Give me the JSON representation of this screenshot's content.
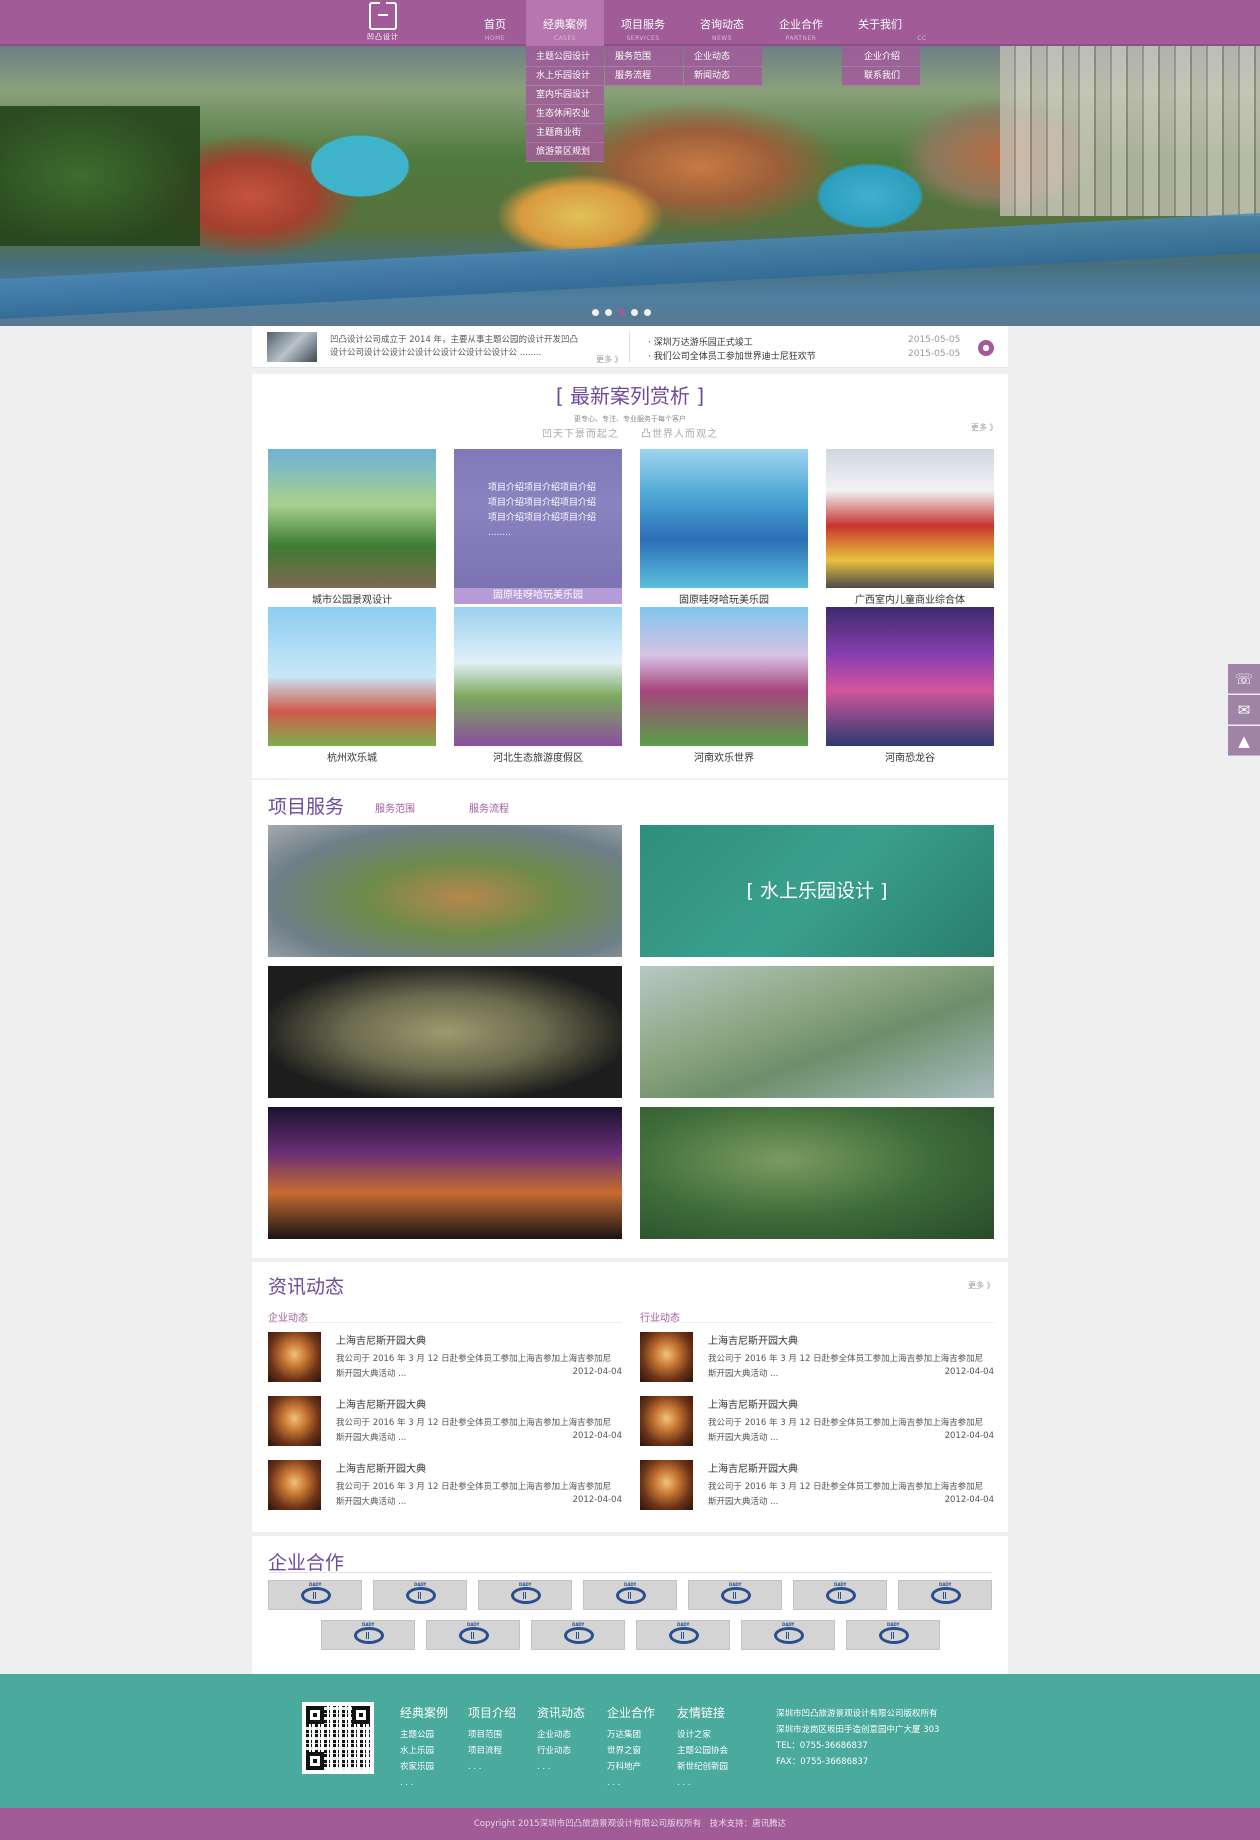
{
  "header": {
    "logo_text": "凹凸设计",
    "nav": [
      {
        "cn": "首页",
        "en": "HOME"
      },
      {
        "cn": "经典案例",
        "en": "CASES"
      },
      {
        "cn": "项目服务",
        "en": "SERVICES"
      },
      {
        "cn": "咨询动态",
        "en": "NEWS"
      },
      {
        "cn": "企业合作",
        "en": "PARTNER"
      },
      {
        "cn": "关于我们",
        "en": "CC"
      }
    ],
    "dropdowns": {
      "cases": [
        "主题公园设计",
        "水上乐园设计",
        "室内乐园设计",
        "生态休闲农业",
        "主题商业街",
        "旅游景区规划"
      ],
      "services": [
        "服务范围",
        "服务流程"
      ],
      "news": [
        "企业动态",
        "新闻动态"
      ],
      "about": [
        "企业介绍",
        "联系我们"
      ]
    }
  },
  "strip": {
    "intro": "凹凸设计公司成立于 2014 年，主要从事主题公园的设计开发凹凸设计公司设计公设计公设计公设计公设计公设计公 ........",
    "more": "更多 》",
    "news": [
      {
        "title": "· 深圳万达游乐园正式竣工",
        "date": "2015-05-05"
      },
      {
        "title": "· 我们公司全体员工参加世界迪士尼狂欢节",
        "date": "2015-05-05"
      }
    ],
    "chat_icon": "chat-icon"
  },
  "cases": {
    "title": "[ 最新案列赏析 ]",
    "subtitle": "更专心、专注、专业服务于每个客户",
    "slogan": "凹天下景而起之　　凸世界人而观之",
    "more": "更多 》",
    "items": [
      {
        "caption": "城市公园景观设计"
      },
      {
        "caption": "固原哇呀哈玩美乐园",
        "overlay": "项目介绍项目介绍项目介绍项目介绍项目介绍项目介绍项目介绍项目介绍项目介绍 ........"
      },
      {
        "caption": "固原哇呀哈玩美乐园"
      },
      {
        "caption": "广西室内儿童商业综合体"
      },
      {
        "caption": "杭州欢乐城"
      },
      {
        "caption": "河北生态旅游度假区"
      },
      {
        "caption": "河南欢乐世界"
      },
      {
        "caption": "河南恐龙谷"
      }
    ]
  },
  "services": {
    "title": "项目服务",
    "tabs": [
      "服务范围",
      "服务流程"
    ],
    "hover_label": "[ 水上乐园设计 ]"
  },
  "news": {
    "title": "资讯动态",
    "more": "更多 》",
    "left_title": "企业动态",
    "right_title": "行业动态",
    "item": {
      "title": "上海吉尼斯开园大典",
      "desc": "我公司于 2016 年 3 月 12 日赴参全体员工参加上海吉参加上海吉参加尼斯开园大典活动 ...",
      "date": "2012-04-04"
    }
  },
  "partners": {
    "title": "企业合作",
    "logo_text": "DADY"
  },
  "side_tools": [
    "phone-icon",
    "chat-icon",
    "back-to-top-icon"
  ],
  "footer": {
    "columns": [
      {
        "title": "经典案例",
        "items": [
          "主题公园",
          "水上乐园",
          "农家乐园",
          ". . ."
        ]
      },
      {
        "title": "项目介绍",
        "items": [
          "项目范围",
          "项目流程",
          ". . ."
        ]
      },
      {
        "title": "资讯动态",
        "items": [
          "企业动态",
          "行业动态",
          ". . ."
        ]
      },
      {
        "title": "企业合作",
        "items": [
          "万达集团",
          "世界之窗",
          "万科地产",
          ". . ."
        ]
      },
      {
        "title": "友情链接",
        "items": [
          "设计之家",
          "主题公园协会",
          "新世纪创新园",
          ". . ."
        ]
      }
    ],
    "info": [
      "深圳市凹凸旅游景观设计有限公司版权所有",
      "深圳市龙岗区坂田手造创意园中广大厦 303",
      "TEL：0755-36686837",
      "FAX：0755-36686837"
    ],
    "copyright": "Copyright 2015深圳市凹凸旅游景观设计有限公司版权所有　技术支持：唐讯腾达"
  },
  "colors": {
    "brand": "#a15c98",
    "accent_title": "#6e4a9b",
    "footer": "#4aaa9e"
  }
}
